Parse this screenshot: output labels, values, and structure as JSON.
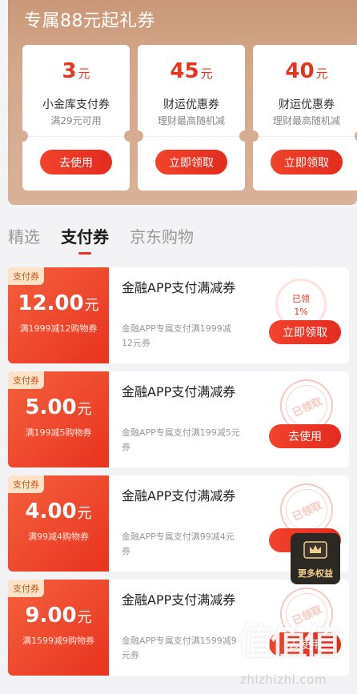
{
  "gift": {
    "title": "专属88元起礼券",
    "cards": [
      {
        "amount": "3",
        "unit": "元",
        "name": "小金库支付券",
        "desc": "满29元可用",
        "button": "去使用"
      },
      {
        "amount": "45",
        "unit": "元",
        "name": "财运优惠券",
        "desc": "理财最高随机减",
        "button": "立即领取"
      },
      {
        "amount": "40",
        "unit": "元",
        "name": "财运优惠券",
        "desc": "理财最高随机减",
        "button": "立即领取"
      }
    ]
  },
  "tabs": [
    {
      "label": "精选",
      "active": false
    },
    {
      "label": "支付券",
      "active": true
    },
    {
      "label": "京东购物",
      "active": false
    }
  ],
  "coupons": [
    {
      "tag": "支付券",
      "amount": "12.00",
      "unit": "元",
      "condition": "满1999减12购物券",
      "title": "金融APP支付满减券",
      "subtitle": "金融APP专属支付满1999减12元券",
      "action": "立即领取",
      "claimed_label": "已领",
      "claimed_percent": "1%",
      "stamp": ""
    },
    {
      "tag": "支付券",
      "amount": "5.00",
      "unit": "元",
      "condition": "满199减5购物券",
      "title": "金融APP支付满减券",
      "subtitle": "金融APP专属支付满199减5元券",
      "action": "去使用",
      "stamp": "已领取"
    },
    {
      "tag": "支付券",
      "amount": "4.00",
      "unit": "元",
      "condition": "满99减4购物券",
      "title": "金融APP支付满减券",
      "subtitle": "金融APP专属支付满99减4元券",
      "action": "去",
      "stamp": "已领取"
    },
    {
      "tag": "支付券",
      "amount": "9.00",
      "unit": "元",
      "condition": "满1599减9购物券",
      "title": "金融APP支付满减券",
      "subtitle": "金融APP专属支付满1599减9元券",
      "action": "去使用",
      "stamp": "已领取"
    }
  ],
  "more_benefits": {
    "label": "更多权益",
    "icon": "crown-badge-icon"
  },
  "watermark": {
    "logo": "值值值",
    "url": "zhizhizhi.com"
  },
  "colors": {
    "accent": "#e8331f",
    "banner": "#d3a98c",
    "floating_bg": "#2c2824",
    "floating_text": "#f2d08a"
  }
}
